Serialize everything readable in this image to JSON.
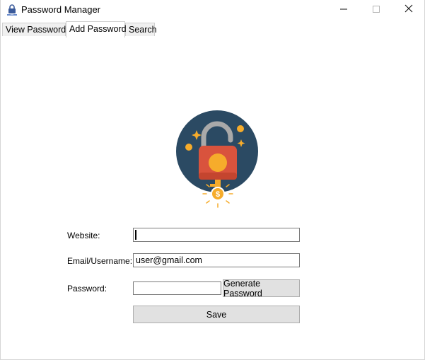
{
  "window": {
    "title": "Password Manager",
    "icon": "padlock-app-icon",
    "controls": [
      "minimize-icon",
      "maximize-icon",
      "close-icon"
    ]
  },
  "tabs": [
    {
      "label": "View Passwords",
      "active": false
    },
    {
      "label": "Add Password",
      "active": true
    },
    {
      "label": "Search",
      "active": false
    }
  ],
  "logo": {
    "icon": "padlock-with-coin-logo",
    "colors": {
      "circle": "#2b4a63",
      "lock_body": "#d9533d",
      "shackle": "#a9a9a9",
      "coin": "#f6ac2b"
    }
  },
  "form": {
    "website_label": "Website:",
    "website_value": "",
    "email_label": "Email/Username:",
    "email_value": "user@gmail.com",
    "password_label": "Password:",
    "password_value": "",
    "generate_button": "Generate Password",
    "save_button": "Save"
  }
}
